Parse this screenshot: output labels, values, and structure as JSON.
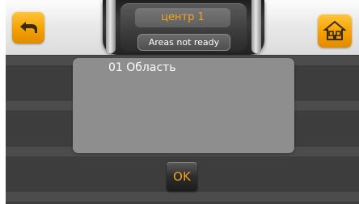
{
  "header": {
    "title": "центр 1",
    "status": "Areas not ready"
  },
  "nav": {
    "back_icon": "back-arrow-icon",
    "home_icon": "home-icon"
  },
  "areas": [
    {
      "label": "01 Область"
    }
  ],
  "buttons": {
    "ok_label": "OK"
  },
  "colors": {
    "accent": "#f5a21a",
    "button_orange": "#f5a100",
    "panel": "#8e8e8e",
    "background": "#3d3d3d"
  }
}
